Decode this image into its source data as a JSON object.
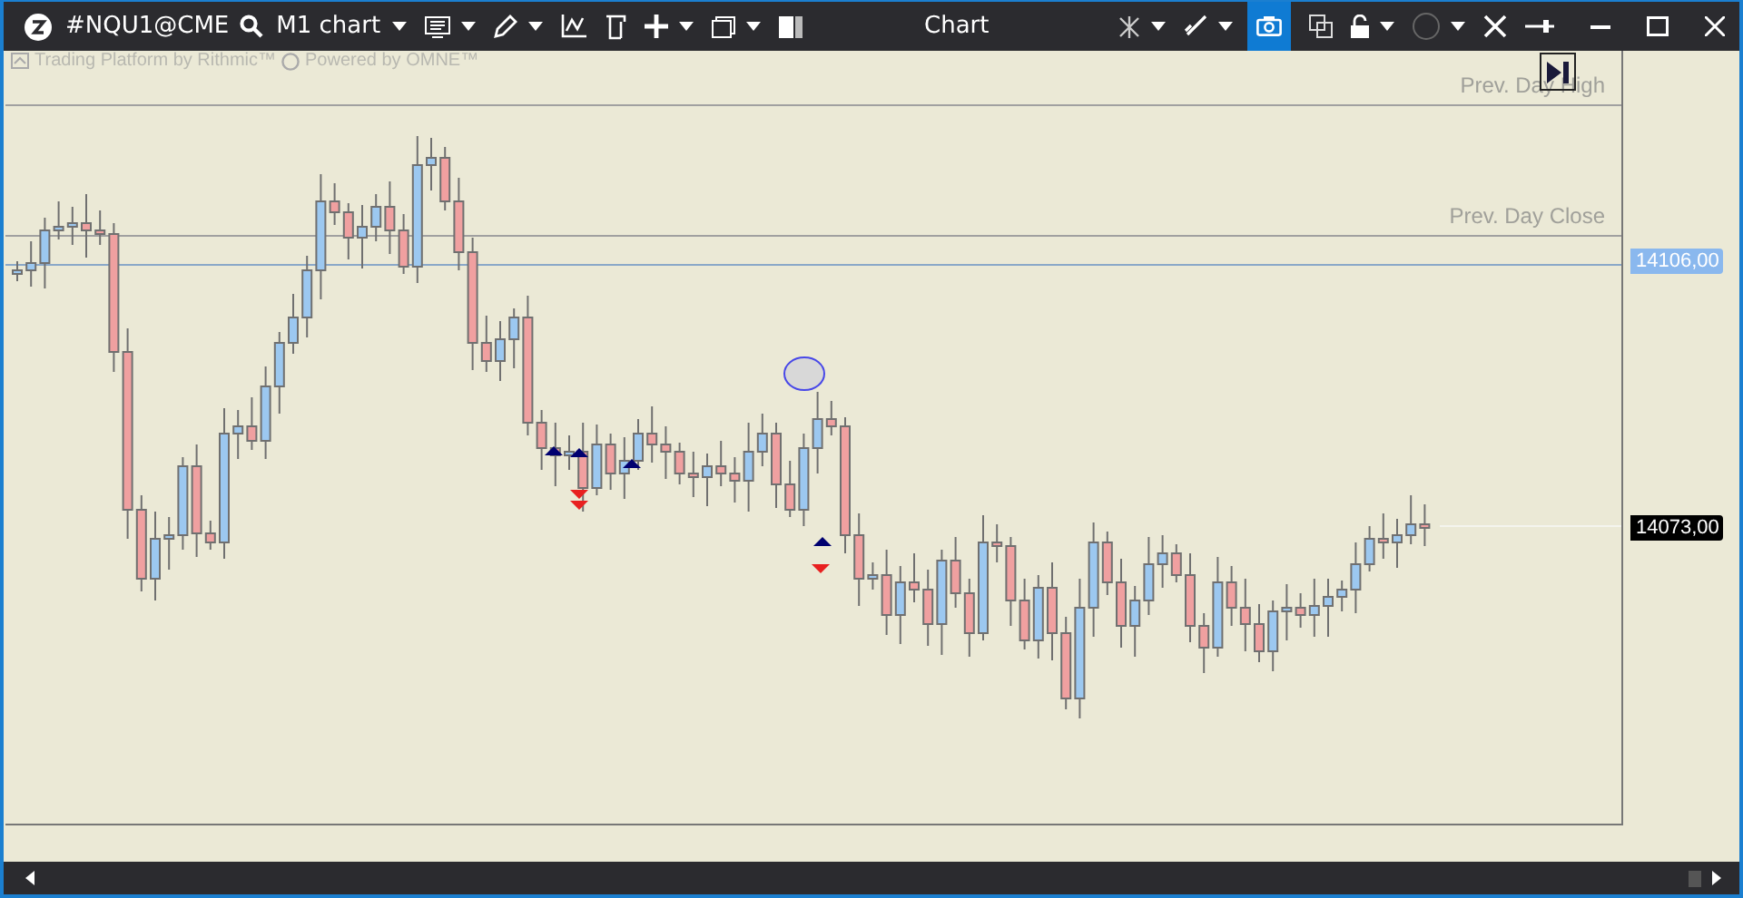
{
  "window": {
    "symbol": "#NQU1@CME",
    "chart_type": "M1 chart",
    "title": "Chart"
  },
  "camera_button": {
    "selected": true
  },
  "watermark": [
    "Trading Platform by Rithmic™",
    "Powered by OMNE™"
  ],
  "levels": [
    {
      "label": "Prev. Day High"
    },
    {
      "label": "Prev. Day Close"
    }
  ],
  "price_labels": [
    {
      "kind": "line",
      "text": "14106,00"
    },
    {
      "kind": "last",
      "text": "14073,00"
    }
  ]
}
